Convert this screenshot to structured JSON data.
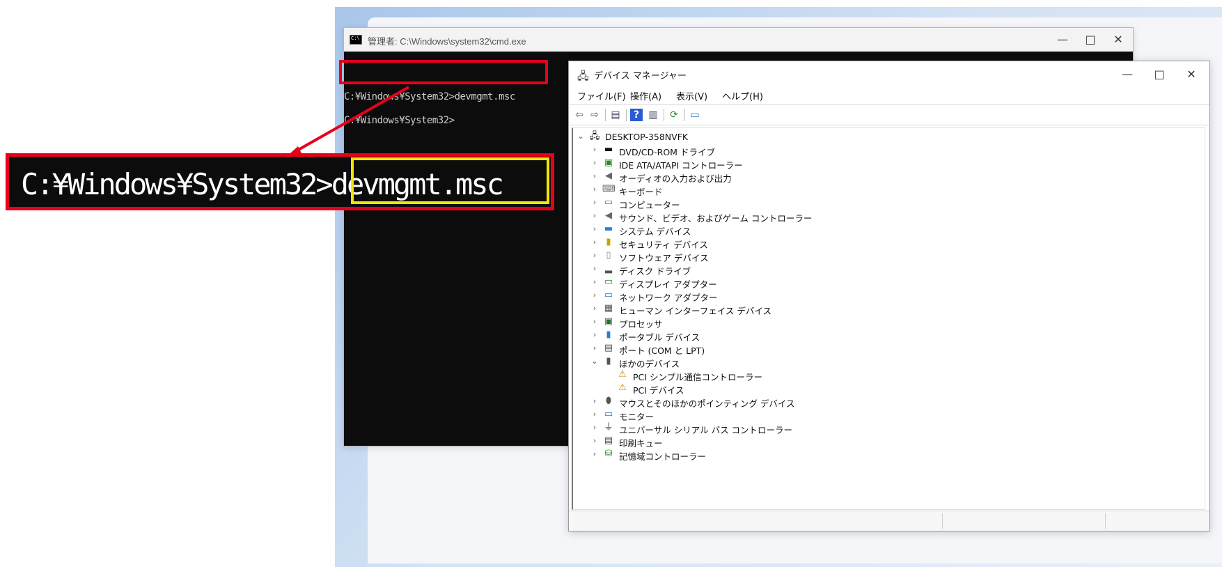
{
  "cmd": {
    "title": "管理者: C:\\Windows\\system32\\cmd.exe",
    "line1": "C:¥Windows¥System32>devmgmt.msc",
    "line2": "C:¥Windows¥System32>",
    "min": "—",
    "max": "□",
    "close": "✕"
  },
  "device_manager": {
    "title": "デバイス マネージャー",
    "menu": [
      "ファイル(F)",
      "操作(A)",
      "表示(V)",
      "ヘルプ(H)"
    ],
    "root": "DESKTOP-358NVFK",
    "items": [
      "DVD/CD-ROM ドライブ",
      "IDE ATA/ATAPI コントローラー",
      "オーディオの入力および出力",
      "キーボード",
      "コンピューター",
      "サウンド、ビデオ、およびゲーム コントローラー",
      "システム デバイス",
      "セキュリティ デバイス",
      "ソフトウェア デバイス",
      "ディスク ドライブ",
      "ディスプレイ アダプター",
      "ネットワーク アダプター",
      "ヒューマン インターフェイス デバイス",
      "プロセッサ",
      "ポータブル デバイス",
      "ポート (COM と LPT)",
      "ほかのデバイス",
      "PCI シンプル通信コントローラー",
      "PCI デバイス",
      "マウスとそのほかのポインティング デバイス",
      "モニター",
      "ユニバーサル シリアル バス コントローラー",
      "印刷キュー",
      "記憶域コントローラー"
    ]
  },
  "callout": {
    "prefix": "C:¥Windows¥System32>",
    "command": "devmgmt.msc"
  }
}
